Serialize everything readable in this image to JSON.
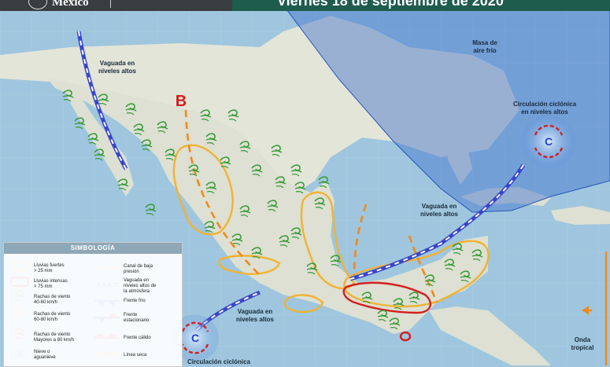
{
  "header": {
    "logo_text": "México",
    "title": "Viernes 18 de septiembre de 2020"
  },
  "map_labels": {
    "masa_aire_frio": "Masa de\naire frío",
    "vaguada_nw": "Vaguada en\nniveles altos",
    "vaguada_e": "Vaguada en\nniveles altos",
    "vaguada_sw": "Vaguada en\nniveles altos",
    "circ_ne": "Circulación ciclónica\nen niveles altos",
    "circ_sw": "Circulación ciclónica",
    "onda_tropical": "Onda\ntropical",
    "baja_presion": "B",
    "centro_c1": "C",
    "centro_c2": "C"
  },
  "legend": {
    "title": "SIMBOLOGÍA",
    "items": [
      {
        "label": "Lluvias fuertes\n> 25 mm",
        "icon": "rain-heavy-icon",
        "color": "#f2b233"
      },
      {
        "label": "Lluvias intensas\n> 75 mm",
        "icon": "rain-intense-icon",
        "color": "#d21f1f"
      },
      {
        "label": "Rachas de viento\n40-60 km/h",
        "icon": "wind-gust-green-icon",
        "color": "#3a9a3a"
      },
      {
        "label": "Rachas de viento\n60-80 km/h",
        "icon": "wind-gust-orange-icon",
        "color": "#f08a1a"
      },
      {
        "label": "Rachas de viento\nMayores a 80 km/h",
        "icon": "wind-gust-red-icon",
        "color": "#d21f1f"
      },
      {
        "label": "Nieve o\naguanieve",
        "icon": "snowflake-icon",
        "color": "#3b7fc4"
      },
      {
        "label": "Canal de baja\npresión",
        "icon": "low-pressure-trough-icon",
        "color": "#f08a1a"
      },
      {
        "label": "Vaguada en\nniveles altos de\nla atmósfera",
        "icon": "upper-trough-icon",
        "color": "#4a55d8"
      },
      {
        "label": "Frente frío",
        "icon": "cold-front-icon",
        "color": "#1f3fd8"
      },
      {
        "label": "Frente\nestacionario",
        "icon": "stationary-front-icon",
        "color": "#1f3fd8"
      },
      {
        "label": "Frente cálido",
        "icon": "warm-front-icon",
        "color": "#cc1f1f"
      },
      {
        "label": "Línea seca",
        "icon": "dry-line-icon",
        "color": "#f08a1a"
      }
    ]
  },
  "colors": {
    "ocean": "#9fc6de",
    "land": "#dfe2d4",
    "cold_air_mass": "#3f6fcf",
    "rain_heavy": "#f2b233",
    "rain_intense": "#d21f1f",
    "wind_green": "#3a9a3a",
    "trough_blue": "#4a55d8",
    "header_green": "#1e5c4c"
  }
}
